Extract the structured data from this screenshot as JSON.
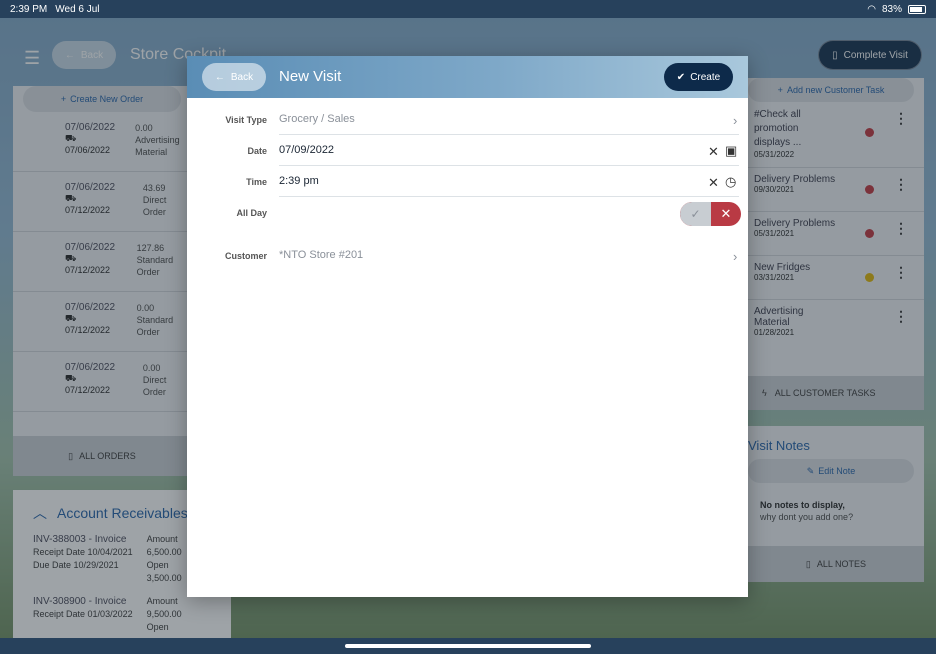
{
  "status_bar": {
    "time": "2:39 PM",
    "date": "Wed 6 Jul",
    "battery": "83%"
  },
  "background": {
    "back_label": "Back",
    "title": "Store Cockpit",
    "complete_visit": "Complete Visit",
    "orders": {
      "create_label": "Create New Order",
      "rows": [
        {
          "date1": "07/06/2022",
          "date2": "07/06/2022",
          "amount": "0.00",
          "type": "Advertising Material"
        },
        {
          "date1": "07/06/2022",
          "date2": "07/12/2022",
          "amount": "43.69",
          "type": "Direct Order"
        },
        {
          "date1": "07/06/2022",
          "date2": "07/12/2022",
          "amount": "127.86",
          "type": "Standard Order"
        },
        {
          "date1": "07/06/2022",
          "date2": "07/12/2022",
          "amount": "0.00",
          "type": "Standard Order"
        },
        {
          "date1": "07/06/2022",
          "date2": "07/12/2022",
          "amount": "0.00",
          "type": "Direct Order"
        }
      ],
      "all_label": "ALL ORDERS"
    },
    "receivables": {
      "title": "Account Receivables",
      "items": [
        {
          "id": "INV-388003 - Invoice",
          "receipt_label": "Receipt Date",
          "receipt": "10/04/2021",
          "due_label": "Due Date",
          "due": "10/29/2021",
          "amount_label": "Amount",
          "amount": "6,500.00",
          "open_label": "Open",
          "open": "3,500.00"
        },
        {
          "id": "INV-308900 - Invoice",
          "receipt_label": "Receipt Date",
          "receipt": "01/03/2022",
          "due_label": "",
          "due": "",
          "amount_label": "Amount",
          "amount": "9,500.00",
          "open_label": "Open",
          "open": ""
        }
      ]
    },
    "tasks": {
      "add_label": "Add new Customer Task",
      "items": [
        {
          "title": "#Check all promotion displays ...",
          "date": "05/31/2022",
          "dot_color": "#c0323b"
        },
        {
          "title": "Delivery Problems",
          "date": "09/30/2021",
          "dot_color": "#c0323b"
        },
        {
          "title": "Delivery Problems",
          "date": "05/31/2021",
          "dot_color": "#c0323b"
        },
        {
          "title": "New Fridges",
          "date": "03/31/2021",
          "dot_color": "#e0b400"
        },
        {
          "title": "Advertising Material",
          "date": "01/28/2021",
          "dot_color": ""
        }
      ],
      "all_label": "ALL CUSTOMER TASKS"
    },
    "notes": {
      "title": "Visit Notes",
      "edit_label": "Edit Note",
      "empty_line1": "No notes to display,",
      "empty_line2": "why dont you add one?",
      "all_label": "ALL NOTES"
    }
  },
  "modal": {
    "back_label": "Back",
    "title": "New Visit",
    "create_label": "Create",
    "fields": {
      "visit_type": {
        "label": "Visit Type",
        "value": "Grocery / Sales"
      },
      "date": {
        "label": "Date",
        "value": "07/09/2022"
      },
      "time": {
        "label": "Time",
        "value": "2:39 pm"
      },
      "all_day": {
        "label": "All Day",
        "value": false
      },
      "customer": {
        "label": "Customer",
        "value": "*NTO Store #201"
      }
    }
  },
  "icons": {
    "accent": "#1f5fa8",
    "primary_dark": "#0d2a4a",
    "toggle_off": "#b93a44"
  }
}
